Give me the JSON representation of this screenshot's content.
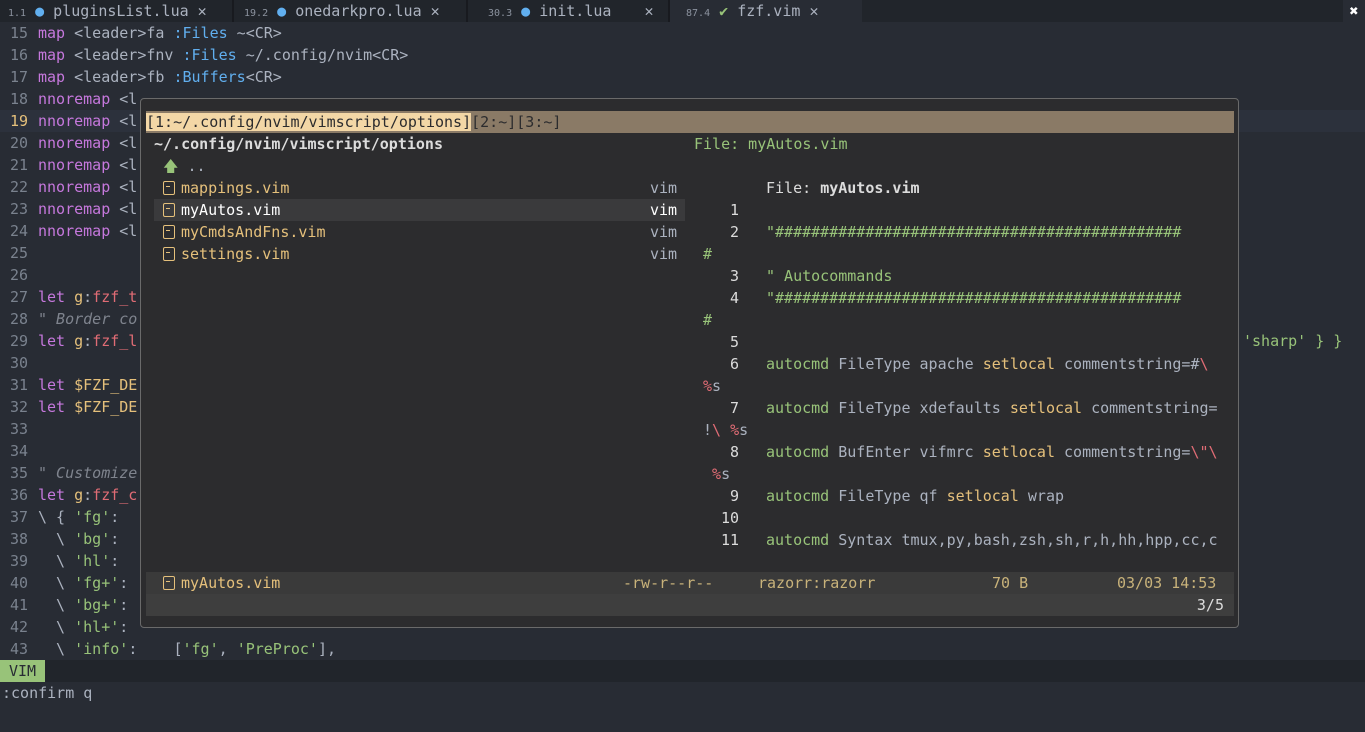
{
  "tabs": [
    {
      "num": "1.",
      "sub": "1",
      "icon": "lua-icon",
      "name": "pluginsList.lua"
    },
    {
      "num": "19.",
      "sub": "2",
      "icon": "lua-icon",
      "name": "onedarkpro.lua"
    },
    {
      "num": "30.",
      "sub": "3",
      "icon": "lua-icon",
      "name": "init.lua"
    },
    {
      "num": "87.",
      "sub": "4",
      "icon": "vim-icon",
      "name": "fzf.vim"
    }
  ],
  "close_all": "✖",
  "tab_close": "✕",
  "editor": {
    "lines": [
      {
        "n": "15",
        "parts": [
          [
            "kw",
            "map "
          ],
          [
            "plain",
            "<leader>fa "
          ],
          [
            "fn",
            ":Files"
          ],
          [
            "plain",
            " ~<CR>"
          ]
        ]
      },
      {
        "n": "16",
        "parts": [
          [
            "kw",
            "map "
          ],
          [
            "plain",
            "<leader>fnv "
          ],
          [
            "fn",
            ":Files"
          ],
          [
            "plain",
            " ~/.config/nvim<CR>"
          ]
        ]
      },
      {
        "n": "17",
        "parts": [
          [
            "kw",
            "map "
          ],
          [
            "plain",
            "<leader>fb "
          ],
          [
            "fn",
            ":Buffers"
          ],
          [
            "plain",
            "<CR>"
          ]
        ]
      },
      {
        "n": "18",
        "parts": [
          [
            "kw",
            "nnoremap "
          ],
          [
            "plain",
            "<l"
          ]
        ]
      },
      {
        "n": "19",
        "parts": [
          [
            "kw",
            "nnoremap "
          ],
          [
            "plain",
            "<l"
          ]
        ]
      },
      {
        "n": "20",
        "parts": [
          [
            "kw",
            "nnoremap "
          ],
          [
            "plain",
            "<l"
          ]
        ]
      },
      {
        "n": "21",
        "parts": [
          [
            "kw",
            "nnoremap "
          ],
          [
            "plain",
            "<l"
          ]
        ]
      },
      {
        "n": "22",
        "parts": [
          [
            "kw",
            "nnoremap "
          ],
          [
            "plain",
            "<l"
          ]
        ]
      },
      {
        "n": "23",
        "parts": [
          [
            "kw",
            "nnoremap "
          ],
          [
            "plain",
            "<l"
          ]
        ]
      },
      {
        "n": "24",
        "parts": [
          [
            "kw",
            "nnoremap "
          ],
          [
            "plain",
            "<l"
          ]
        ]
      },
      {
        "n": "25",
        "parts": []
      },
      {
        "n": "26",
        "parts": []
      },
      {
        "n": "27",
        "parts": [
          [
            "kw",
            "let "
          ],
          [
            "var",
            "g"
          ],
          [
            "plain",
            ":"
          ],
          [
            "red",
            "fzf_t"
          ]
        ]
      },
      {
        "n": "28",
        "parts": [
          [
            "com",
            "\" Border co"
          ]
        ]
      },
      {
        "n": "29",
        "parts": [
          [
            "kw",
            "let "
          ],
          [
            "var",
            "g"
          ],
          [
            "plain",
            ":"
          ],
          [
            "red",
            "fzf_l"
          ]
        ]
      },
      {
        "n": "30",
        "parts": []
      },
      {
        "n": "31",
        "parts": [
          [
            "kw",
            "let "
          ],
          [
            "var",
            "$FZF_DE"
          ]
        ]
      },
      {
        "n": "32",
        "parts": [
          [
            "kw",
            "let "
          ],
          [
            "var",
            "$FZF_DE"
          ]
        ]
      },
      {
        "n": "33",
        "parts": []
      },
      {
        "n": "34",
        "parts": []
      },
      {
        "n": "35",
        "parts": [
          [
            "com",
            "\" Customize"
          ]
        ]
      },
      {
        "n": "36",
        "parts": [
          [
            "kw",
            "let "
          ],
          [
            "var",
            "g"
          ],
          [
            "plain",
            ":"
          ],
          [
            "red",
            "fzf_c"
          ]
        ]
      },
      {
        "n": "37",
        "parts": [
          [
            "plain",
            "\\ { "
          ],
          [
            "str",
            "'fg'"
          ],
          [
            "plain",
            ":"
          ]
        ]
      },
      {
        "n": "38",
        "parts": [
          [
            "plain",
            "  \\ "
          ],
          [
            "str",
            "'bg'"
          ],
          [
            "plain",
            ":"
          ]
        ]
      },
      {
        "n": "39",
        "parts": [
          [
            "plain",
            "  \\ "
          ],
          [
            "str",
            "'hl'"
          ],
          [
            "plain",
            ":"
          ]
        ]
      },
      {
        "n": "40",
        "parts": [
          [
            "plain",
            "  \\ "
          ],
          [
            "str",
            "'fg+'"
          ],
          [
            "plain",
            ":"
          ]
        ]
      },
      {
        "n": "41",
        "parts": [
          [
            "plain",
            "  \\ "
          ],
          [
            "str",
            "'bg+'"
          ],
          [
            "plain",
            ":"
          ]
        ]
      },
      {
        "n": "42",
        "parts": [
          [
            "plain",
            "  \\ "
          ],
          [
            "str",
            "'hl+'"
          ],
          [
            "plain",
            ":"
          ]
        ]
      },
      {
        "n": "43",
        "parts": [
          [
            "plain",
            "  \\ "
          ],
          [
            "str",
            "'info'"
          ],
          [
            "plain",
            ":    ["
          ],
          [
            "str",
            "'fg'"
          ],
          [
            "plain",
            ", "
          ],
          [
            "str",
            "'PreProc'"
          ],
          [
            "plain",
            "],"
          ]
        ]
      }
    ],
    "line29_tail": "'sharp' } }",
    "current_line": "19"
  },
  "fzf": {
    "tabbar": {
      "active": "[1:~/.config/nvim/vimscript/options]",
      "rest": "[2:~][3:~]"
    },
    "cwd": "~/.config/nvim/vimscript/options",
    "preview_header": "File: myAutos.vim",
    "up_dir": "..",
    "files": [
      {
        "name": "mappings.vim",
        "ext": "vim"
      },
      {
        "name": "myAutos.vim",
        "ext": "vim"
      },
      {
        "name": "myCmdsAndFns.vim",
        "ext": "vim"
      },
      {
        "name": "settings.vim",
        "ext": "vim"
      }
    ],
    "preview_title_label": "File: ",
    "preview_title_file": "myAutos.vim",
    "preview_lines": [
      {
        "n": "1",
        "parts": []
      },
      {
        "n": "2",
        "parts": [
          [
            "pvs",
            "\"#############################################"
          ]
        ]
      },
      {
        "n": "",
        "wrap": true,
        "parts": [
          [
            "pvs",
            "#"
          ]
        ]
      },
      {
        "n": "3",
        "parts": [
          [
            "pvs",
            "\" Autocommands"
          ]
        ]
      },
      {
        "n": "4",
        "parts": [
          [
            "pvs",
            "\"#############################################"
          ]
        ]
      },
      {
        "n": "",
        "wrap": true,
        "parts": [
          [
            "pvs",
            "#"
          ]
        ]
      },
      {
        "n": "5",
        "parts": []
      },
      {
        "n": "6",
        "parts": [
          [
            "pvs",
            "autocmd "
          ],
          [
            "plain",
            "FileType apache "
          ],
          [
            "pv",
            "setlocal "
          ],
          [
            "plain",
            "commentstring=#"
          ],
          [
            "pvr",
            "\\"
          ]
        ]
      },
      {
        "n": "",
        "wrap": true,
        "parts": [
          [
            "pvr",
            "%"
          ],
          [
            "plain",
            "s"
          ]
        ]
      },
      {
        "n": "7",
        "parts": [
          [
            "pvs",
            "autocmd "
          ],
          [
            "plain",
            "FileType xdefaults "
          ],
          [
            "pv",
            "setlocal "
          ],
          [
            "plain",
            "commentstring="
          ]
        ]
      },
      {
        "n": "",
        "wrap": true,
        "parts": [
          [
            "plain",
            "!"
          ],
          [
            "pvr",
            "\\ %"
          ],
          [
            "plain",
            "s"
          ]
        ]
      },
      {
        "n": "8",
        "parts": [
          [
            "pvs",
            "autocmd "
          ],
          [
            "plain",
            "BufEnter vifmrc "
          ],
          [
            "pv",
            "setlocal "
          ],
          [
            "plain",
            "commentstring="
          ],
          [
            "pvr",
            "\\\"\\"
          ]
        ]
      },
      {
        "n": "",
        "wrap": true,
        "parts": [
          [
            "plain",
            " "
          ],
          [
            "pvr",
            "%"
          ],
          [
            "plain",
            "s"
          ]
        ]
      },
      {
        "n": "9",
        "parts": [
          [
            "pvs",
            "autocmd "
          ],
          [
            "plain",
            "FileType qf "
          ],
          [
            "pv",
            "setlocal "
          ],
          [
            "plain",
            "wrap"
          ]
        ]
      },
      {
        "n": "10",
        "parts": []
      },
      {
        "n": "11",
        "parts": [
          [
            "pvs",
            "autocmd "
          ],
          [
            "plain",
            "Syntax tmux,py,bash,zsh,sh,r,h,hh,hpp,cc,c"
          ]
        ]
      }
    ],
    "status": {
      "file": "myAutos.vim",
      "perms": "-rw-r--r--",
      "owner": "razorr:razorr",
      "size": "70 B",
      "date": "03/03 14:53"
    },
    "count": "3/5"
  },
  "statusline": {
    "mode": "VIM"
  },
  "cmdline": ":confirm q"
}
